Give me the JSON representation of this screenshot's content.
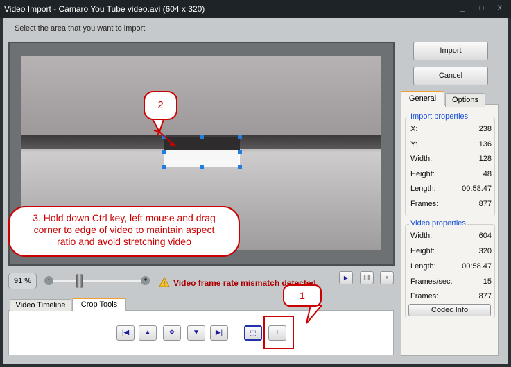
{
  "window": {
    "title": "Video Import - Camaro You Tube video.avi  (604 x 320)",
    "minimize": "_",
    "maximize": "□",
    "close": "X"
  },
  "instruction": "Select the area that you want to import",
  "buttons": {
    "import": "Import",
    "cancel": "Cancel",
    "codec_info": "Codec Info"
  },
  "tabs": {
    "general": "General",
    "options": "Options"
  },
  "import_properties": {
    "title": "Import properties",
    "rows": [
      {
        "label": "X:",
        "value": "238"
      },
      {
        "label": "Y:",
        "value": "136"
      },
      {
        "label": "Width:",
        "value": "128"
      },
      {
        "label": "Height:",
        "value": "48"
      },
      {
        "label": "Length:",
        "value": "00:58.47"
      },
      {
        "label": "Frames:",
        "value": "877"
      }
    ]
  },
  "video_properties": {
    "title": "Video properties",
    "rows": [
      {
        "label": "Width:",
        "value": "604"
      },
      {
        "label": "Height:",
        "value": "320"
      },
      {
        "label": "Length:",
        "value": "00:58.47"
      },
      {
        "label": "Frames/sec:",
        "value": "15"
      },
      {
        "label": "Frames:",
        "value": "877"
      }
    ]
  },
  "zoom": {
    "value": "91 %",
    "minus": "-",
    "plus": "+",
    "slider_fraction": 0.28
  },
  "warning": "Video frame rate mismatch detected",
  "bottom_tabs": {
    "timeline": "Video Timeline",
    "crop": "Crop Tools"
  },
  "callouts": {
    "one": "1",
    "two": "2",
    "three": "3. Hold down Ctrl key, left mouse and drag corner to edge of video to maintain aspect ratio and avoid stretching video"
  },
  "colors": {
    "accent": "#cc0000",
    "link": "#1a4fd6"
  }
}
